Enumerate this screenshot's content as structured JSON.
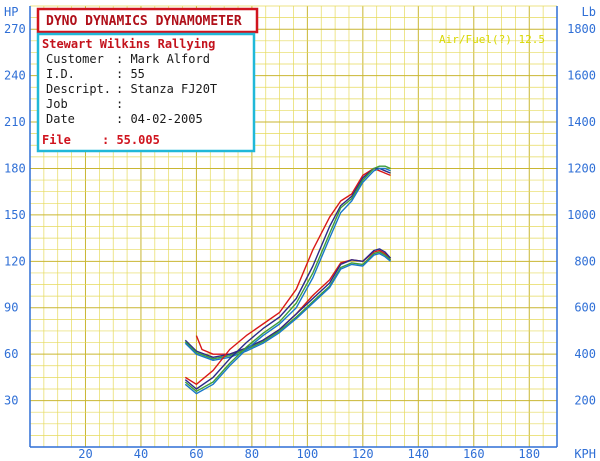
{
  "header": {
    "title": "DYNO DYNAMICS DYNAMOMETER",
    "air_readout": "Air/Fuel(?) 12.5"
  },
  "info": {
    "company": "Stewart Wilkins Rallying",
    "rows": [
      {
        "label": "Customer",
        "value": ": Mark Alford"
      },
      {
        "label": "I.D.",
        "value": ":  55"
      },
      {
        "label": "Descript.",
        "value": ": Stanza FJ20T"
      },
      {
        "label": "Job",
        "value": ":"
      },
      {
        "label": "Date",
        "value": ":  04-02-2005"
      }
    ],
    "file_label": "File",
    "file_value": ":  55.005"
  },
  "colors": {
    "grid": "#e6da5c",
    "grid_bold": "#c9b632",
    "axis_text": "#2f6fd6",
    "title_border": "#d0141e",
    "title_text": "#b0101a",
    "info_border": "#20b8d8",
    "info_text": "#1a1a1a",
    "company_text": "#c4121c",
    "file_text": "#d0141e",
    "air_text": "#d8d800"
  },
  "chart_data": {
    "type": "line",
    "x_unit_label": "KPH",
    "y_left_unit": "HP",
    "y_right_unit": "Lb",
    "xlim": [
      0,
      190
    ],
    "ylim_left": [
      0,
      285
    ],
    "ylim_right": [
      0,
      1900
    ],
    "x_ticks": [
      20,
      40,
      60,
      80,
      100,
      120,
      140,
      160,
      180
    ],
    "y_left_ticks": [
      30,
      60,
      90,
      120,
      150,
      180,
      210,
      240,
      270
    ],
    "y_right_ticks": [
      200,
      400,
      600,
      800,
      1000,
      1200,
      1400,
      1600,
      1800
    ],
    "grid": true,
    "series": [
      {
        "quantity": "power",
        "axis": "left",
        "color": "#d81818",
        "x": [
          60,
          62,
          66,
          72,
          78,
          84,
          90,
          96,
          102,
          108,
          112,
          116,
          120,
          124,
          126,
          128,
          130
        ],
        "y": [
          72,
          63,
          60,
          60,
          64,
          69,
          76,
          86,
          98,
          108,
          119,
          121,
          120,
          126,
          127,
          125,
          121
        ]
      },
      {
        "quantity": "power",
        "axis": "left",
        "color": "#2a2a8a",
        "x": [
          56,
          60,
          66,
          72,
          78,
          84,
          90,
          96,
          102,
          108,
          112,
          116,
          120,
          124,
          126,
          128,
          130
        ],
        "y": [
          69,
          62,
          58,
          60,
          64,
          69,
          76,
          86,
          96,
          106,
          118,
          121,
          120,
          127,
          128,
          126,
          122
        ]
      },
      {
        "quantity": "power",
        "axis": "left",
        "color": "#3c9c3c",
        "x": [
          56,
          60,
          66,
          72,
          78,
          84,
          90,
          96,
          102,
          108,
          112,
          116,
          120,
          124,
          126,
          128,
          130
        ],
        "y": [
          68,
          61,
          57,
          59,
          63,
          68,
          75,
          84,
          94,
          104,
          116,
          119,
          118,
          125,
          126,
          124,
          121
        ]
      },
      {
        "quantity": "power",
        "axis": "left",
        "color": "#1878c8",
        "x": [
          56,
          60,
          66,
          72,
          78,
          84,
          90,
          96,
          102,
          108,
          112,
          116,
          120,
          124,
          126,
          128,
          130
        ],
        "y": [
          67,
          60,
          56,
          58,
          62,
          67,
          74,
          83,
          93,
          103,
          115,
          118,
          117,
          124,
          125,
          123,
          120
        ]
      },
      {
        "quantity": "force",
        "axis": "right",
        "color": "#d81818",
        "x": [
          56,
          60,
          66,
          72,
          78,
          84,
          90,
          96,
          102,
          108,
          112,
          116,
          120,
          124,
          126,
          128,
          130
        ],
        "y": [
          300,
          270,
          330,
          420,
          480,
          530,
          580,
          680,
          850,
          990,
          1060,
          1090,
          1170,
          1200,
          1190,
          1180,
          1170
        ]
      },
      {
        "quantity": "force",
        "axis": "right",
        "color": "#2a2a8a",
        "x": [
          56,
          60,
          66,
          72,
          78,
          84,
          90,
          96,
          102,
          108,
          112,
          116,
          120,
          124,
          126,
          128,
          130
        ],
        "y": [
          290,
          250,
          300,
          380,
          450,
          510,
          560,
          640,
          780,
          950,
          1040,
          1080,
          1160,
          1200,
          1200,
          1190,
          1180
        ]
      },
      {
        "quantity": "force",
        "axis": "right",
        "color": "#3c9c3c",
        "x": [
          56,
          60,
          66,
          72,
          78,
          84,
          90,
          96,
          102,
          108,
          112,
          116,
          120,
          124,
          126,
          128,
          130
        ],
        "y": [
          280,
          240,
          280,
          360,
          430,
          490,
          540,
          620,
          750,
          920,
          1030,
          1070,
          1150,
          1200,
          1210,
          1210,
          1200
        ]
      },
      {
        "quantity": "force",
        "axis": "right",
        "color": "#1878c8",
        "x": [
          56,
          60,
          66,
          72,
          78,
          84,
          90,
          96,
          102,
          108,
          112,
          116,
          120,
          124,
          126,
          128,
          130
        ],
        "y": [
          270,
          230,
          270,
          350,
          420,
          480,
          530,
          600,
          730,
          900,
          1010,
          1060,
          1140,
          1190,
          1200,
          1200,
          1190
        ]
      }
    ]
  }
}
